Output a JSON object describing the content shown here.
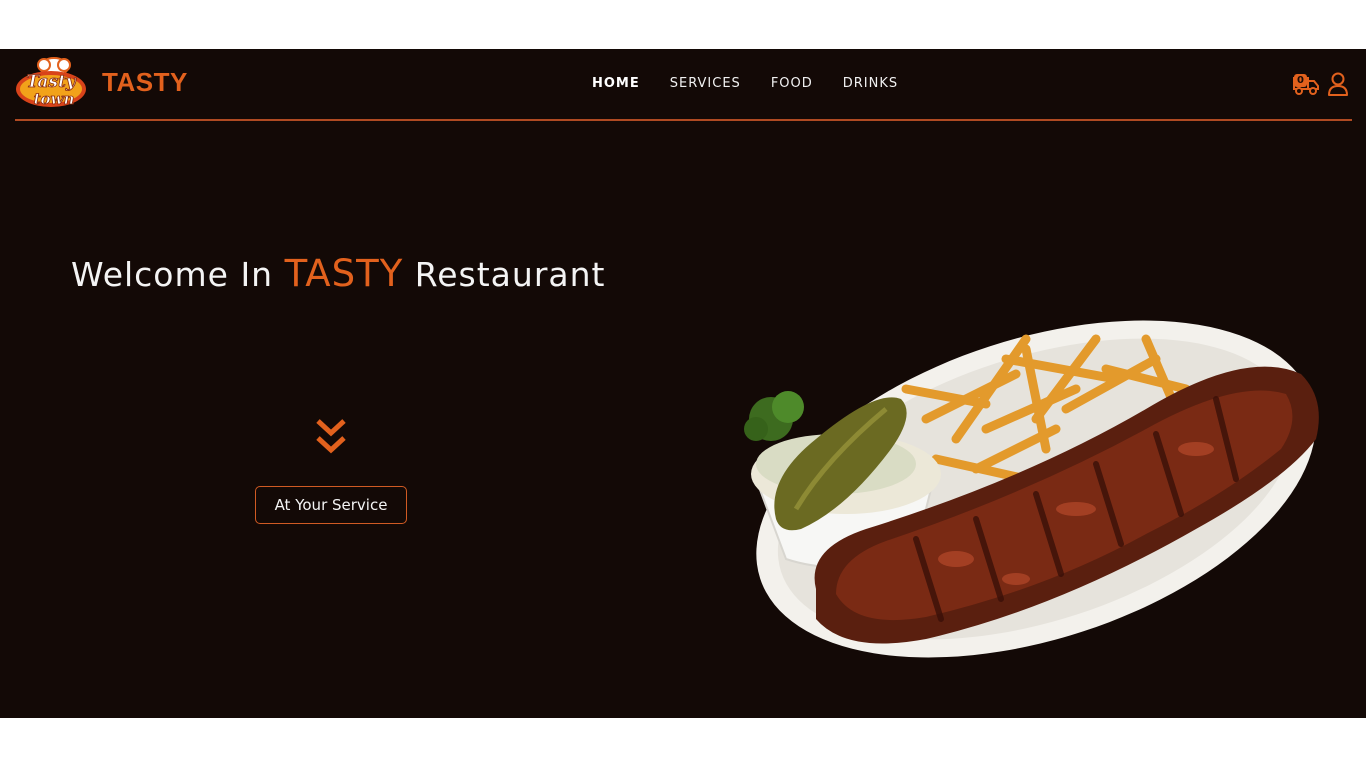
{
  "header": {
    "logo_text_line1": "Tasty",
    "logo_text_line2": "town",
    "brand": "TASTY",
    "nav": [
      {
        "label": "HOME",
        "active": true
      },
      {
        "label": "SERVICES",
        "active": false
      },
      {
        "label": "FOOD",
        "active": false
      },
      {
        "label": "DRINKS",
        "active": false
      }
    ],
    "cart_count": "0",
    "cart_icon": "delivery-truck-icon",
    "user_icon": "user-icon"
  },
  "hero": {
    "title_part1": "Welcome In ",
    "title_accent": "TASTY",
    "title_part2": " Restaurant",
    "chevron_icon": "double-chevron-down-icon",
    "button_label": "At Your Service",
    "image": "ribs-plate-image"
  },
  "colors": {
    "background": "#130906",
    "accent": "#e2611d",
    "text": "#f4f4f4",
    "divider": "#b04a22"
  }
}
